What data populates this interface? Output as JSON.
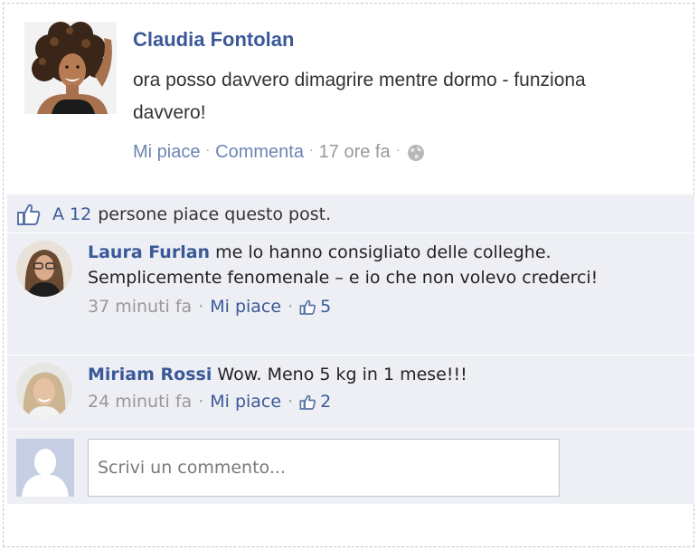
{
  "post": {
    "author": "Claudia Fontolan",
    "text": "ora posso davvero dimagrire mentre dormo - funziona davvero!",
    "actions": {
      "like_label": "Mi piace",
      "comment_label": "Commenta",
      "time": "17 ore fa",
      "separator": "·"
    }
  },
  "likes": {
    "count_label": "A 12",
    "suffix": "persone piace questo post."
  },
  "comments": [
    {
      "author": "Laura Furlan",
      "text": "me lo hanno consigliato delle colleghe. Semplicemente fenomenale – e io che non volevo crederci!",
      "time": "37 minuti fa",
      "like_label": "Mi piace",
      "likes": "5"
    },
    {
      "author": "Miriam Rossi",
      "text": "Wow. Meno 5 kg in 1 mese!!!",
      "time": "24 minuti fa",
      "like_label": "Mi piace",
      "likes": "2"
    }
  ],
  "composer": {
    "placeholder": "Scrivi un commento..."
  },
  "icons": {
    "globe": "globe-icon",
    "thumbs_up": "thumbs-up-icon",
    "placeholder_avatar": "default-profile-icon"
  },
  "colors": {
    "link": "#3b5998",
    "action_link": "#6d84b4",
    "feedback_bg": "#edeff4",
    "muted": "#999999"
  }
}
